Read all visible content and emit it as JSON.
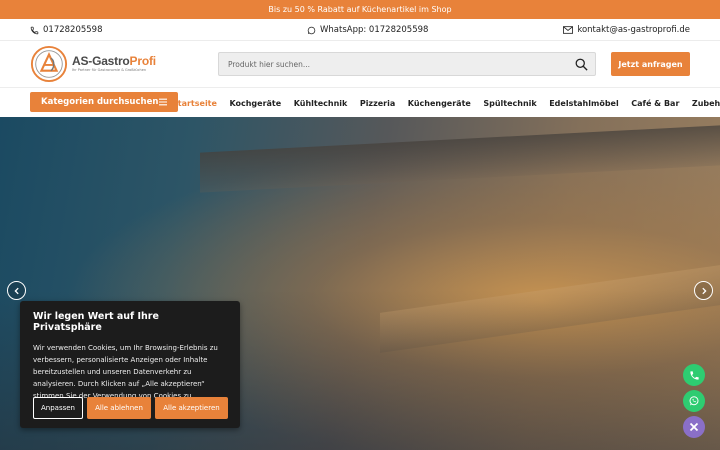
{
  "topbar": {
    "text": "Bis zu 50 % Rabatt auf Küchenartikel im Shop"
  },
  "contact": {
    "phone": "01728205598",
    "whatsapp": "WhatsApp: 01728205598",
    "email": "kontakt@as-gastroprofi.de"
  },
  "logo": {
    "title_main": "AS-Gastro",
    "title_accent": "Profi",
    "subtitle": "Ihr Partner für Gastronomie & Großküchen"
  },
  "search": {
    "placeholder": "Produkt hier suchen..."
  },
  "header": {
    "cta_label": "Jetzt anfragen"
  },
  "nav": {
    "categories_label": "Kategorien durchsuchen",
    "items": [
      {
        "label": "Startseite"
      },
      {
        "label": "Kochgeräte"
      },
      {
        "label": "Kühltechnik"
      },
      {
        "label": "Pizzeria"
      },
      {
        "label": "Küchengeräte"
      },
      {
        "label": "Spültechnik"
      },
      {
        "label": "Edelstahlmöbel"
      },
      {
        "label": "Café & Bar"
      },
      {
        "label": "Zubehör"
      }
    ]
  },
  "cookie": {
    "title": "Wir legen Wert auf Ihre Privatsphäre",
    "text": "Wir verwenden Cookies, um Ihr Browsing-Erlebnis zu verbessern, personalisierte Anzeigen oder Inhalte bereitzustellen und unseren Datenverkehr zu analysieren. Durch Klicken auf „Alle akzeptieren“ stimmen Sie der Verwendung von Cookies zu.",
    "customize_label": "Anpassen",
    "reject_label": "Alle ablehnen",
    "accept_label": "Alle akzeptieren"
  },
  "colors": {
    "accent": "#e8823a",
    "cookie_bg": "#1c1c1c",
    "fab_green": "#2ecc71",
    "fab_purple": "#8a6fc8"
  },
  "icons": [
    "phone-icon",
    "whatsapp-icon",
    "mail-icon",
    "search-icon",
    "menu-icon",
    "chevron-left-icon",
    "chevron-right-icon",
    "close-icon"
  ]
}
